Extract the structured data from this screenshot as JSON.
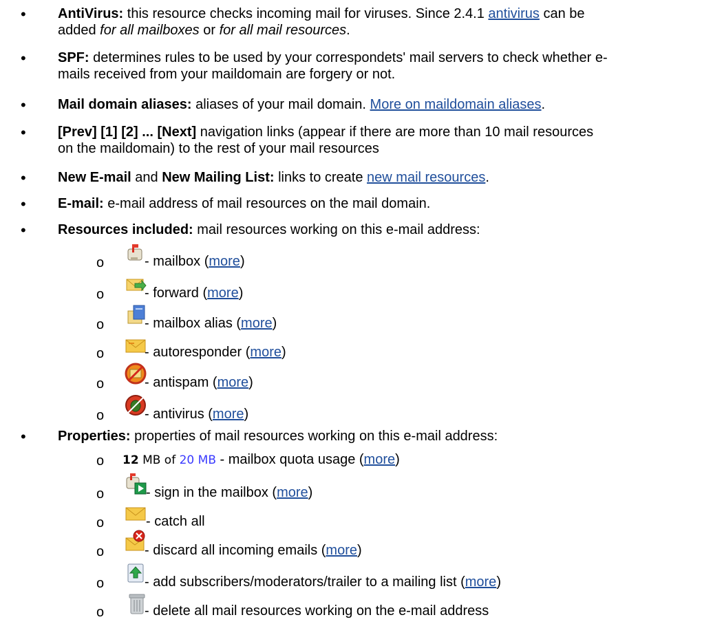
{
  "items": [
    {
      "label": "AntiVirus:",
      "t1": " this resource checks incoming mail for viruses. Since 2.4.1 ",
      "link": "antivirus",
      "t2": " can be",
      "t3": "added ",
      "it1": "for all mailboxes",
      "t4": " or ",
      "it2": "for all mail resources",
      "t5": "."
    },
    {
      "label": "SPF:",
      "t1": " determines rules to be used by your correspondets' mail servers to check whether e-",
      "t2": "mails received from your maildomain are forgery or not."
    },
    {
      "label": "Mail domain aliases:",
      "t1": " aliases of your mail domain. ",
      "link": "More on maildomain aliases",
      "t2": "."
    },
    {
      "label": "[Prev] [1] [2] ... [Next]",
      "t1": " navigation links (appear if there are more than 10 mail resources",
      "t2": "on the maildomain) to the rest of your mail resources"
    },
    {
      "label": "New E-mail",
      "t1": " and ",
      "label2": "New Mailing List:",
      "t2": " links to create ",
      "link": "new mail resources",
      "t3": "."
    },
    {
      "label": "E-mail:",
      "t1": " e-mail address of mail resources on the mail domain."
    },
    {
      "label": "Resources included:",
      "t1": " mail resources working on this e-mail address:"
    },
    {
      "label": "Properties:",
      "t1": " properties of mail resources working on this e-mail address:"
    }
  ],
  "bullet_char": "•",
  "sub_bullet_char": "o",
  "resources": [
    {
      "icon": "mailbox-icon",
      "text": " - mailbox (",
      "link": "more",
      "end": ")"
    },
    {
      "icon": "forward-icon",
      "text": " - forward (",
      "link": "more",
      "end": ")"
    },
    {
      "icon": "mailbox-alias-icon",
      "text": " - mailbox alias (",
      "link": "more",
      "end": ")"
    },
    {
      "icon": "autoresponder-icon",
      "text": " - autoresponder (",
      "link": "more",
      "end": ")"
    },
    {
      "icon": "antispam-icon",
      "text": " - antispam (",
      "link": "more",
      "end": ")"
    },
    {
      "icon": "antivirus-icon",
      "text": " - antivirus (",
      "link": "more",
      "end": ")"
    }
  ],
  "properties": [
    {
      "quota_used": "12",
      "quota_mid": " MB of ",
      "quota_total": "20 MB",
      "text": " - mailbox quota usage (",
      "link": "more",
      "end": ")"
    },
    {
      "icon": "sign-in-mailbox-icon",
      "text": "- sign in the mailbox (",
      "link": "more",
      "end": ")"
    },
    {
      "icon": "catch-all-icon",
      "text": "- catch all"
    },
    {
      "icon": "discard-icon",
      "text": " - discard all incoming emails (",
      "link": "more",
      "end": ")"
    },
    {
      "icon": "add-subscribers-icon",
      "text": " - add subscribers/moderators/trailer to a mailing list (",
      "link": "more",
      "end": ")"
    },
    {
      "icon": "trash-icon",
      "text": " - delete all mail resources working on the e-mail address"
    }
  ]
}
